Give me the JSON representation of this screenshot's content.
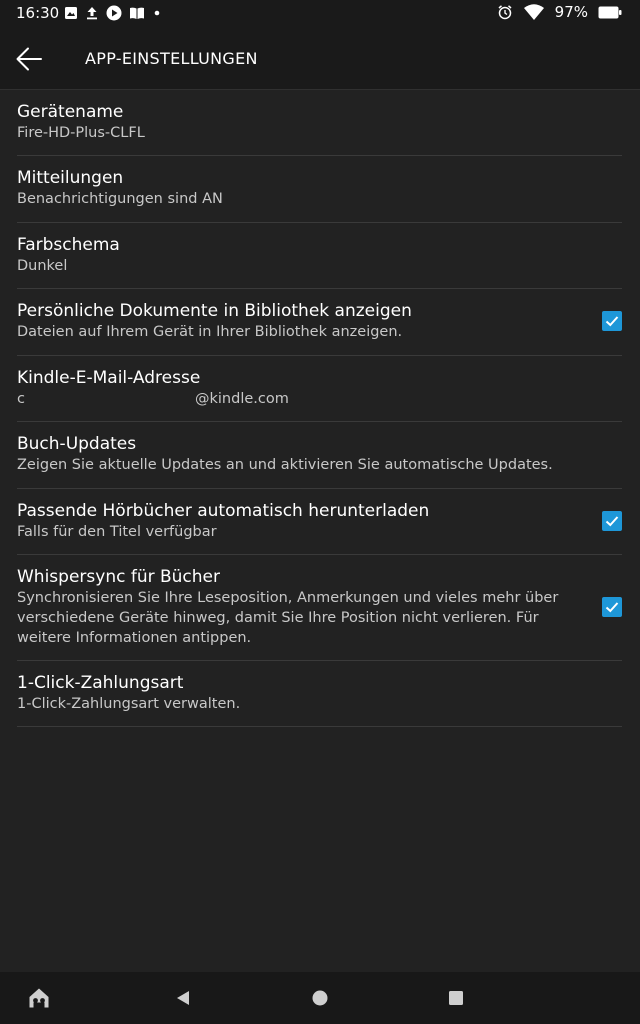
{
  "status_bar": {
    "time": "16:30",
    "battery": "97%",
    "left_icons": [
      "image-icon",
      "upload-icon",
      "play-icon",
      "book-icon",
      "dot-icon"
    ],
    "right_icons": [
      "alarm-icon",
      "wifi-icon",
      "battery-icon"
    ]
  },
  "header": {
    "title": "APP-EINSTELLUNGEN",
    "back_icon": "back-arrow-icon"
  },
  "colors": {
    "background": "#222222",
    "header": "#1a1a1a",
    "accent": "#1e97d8",
    "divider": "#3a3a3a"
  },
  "settings": [
    {
      "title": "Gerätename",
      "subtitle": "Fire-HD-Plus-CLFL"
    },
    {
      "title": "Mitteilungen",
      "subtitle": "Benachrichtigungen sind AN"
    },
    {
      "title": "Farbschema",
      "subtitle": "Dunkel"
    },
    {
      "title": "Persönliche Dokumente in Bibliothek anzeigen",
      "subtitle": "Dateien auf Ihrem Gerät in Ihrer Bibliothek anzeigen.",
      "checked": true
    },
    {
      "title": "Kindle-E-Mail-Adresse",
      "subtitle_prefix": "c",
      "subtitle_domain": "@kindle.com"
    },
    {
      "title": "Buch-Updates",
      "subtitle": "Zeigen Sie aktuelle Updates an und aktivieren Sie automatische Updates."
    },
    {
      "title": "Passende Hörbücher automatisch herunterladen",
      "subtitle": "Falls für den Titel verfügbar",
      "checked": true
    },
    {
      "title": "Whispersync für Bücher",
      "subtitle": "Synchronisieren Sie Ihre Leseposition, Anmerkungen und vieles mehr über verschiedene Geräte hinweg, damit Sie Ihre Position nicht verlieren. Für weitere Informationen antippen.",
      "checked": true
    },
    {
      "title": "1-Click-Zahlungsart",
      "subtitle": "1-Click-Zahlungsart verwalten."
    }
  ],
  "nav_bar": {
    "icons": [
      "home-icon",
      "back-triangle-icon",
      "home-circle-icon",
      "recents-square-icon"
    ]
  }
}
